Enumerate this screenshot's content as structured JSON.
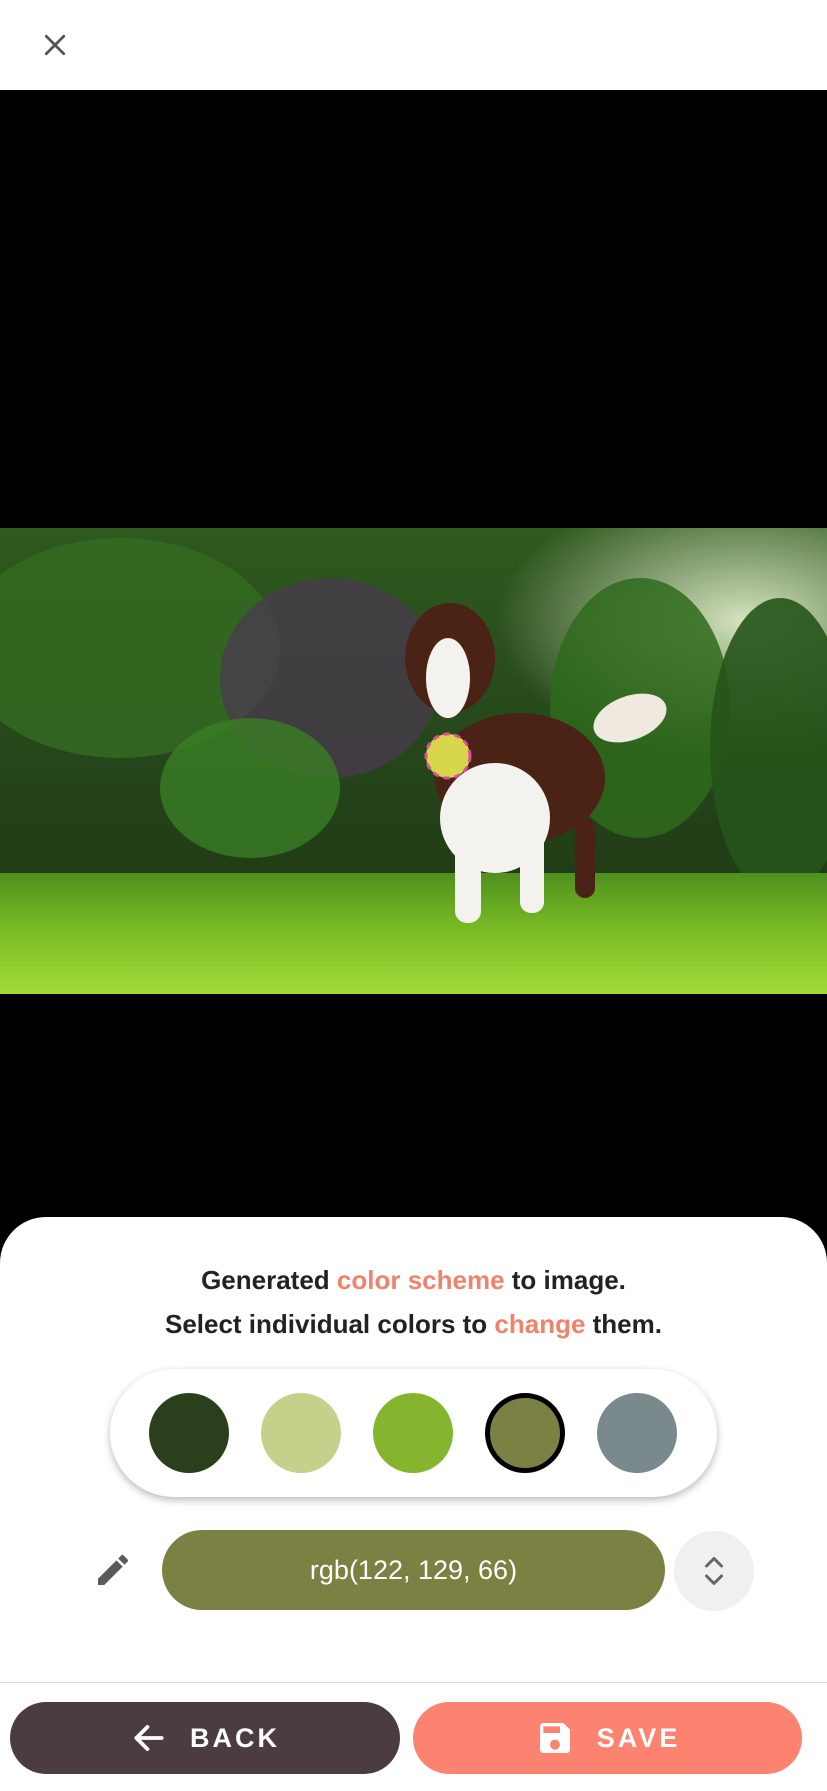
{
  "caption": {
    "line1_before": "Generated ",
    "line1_highlight": "color scheme",
    "line1_after": " to image.",
    "line2_before": "Select individual colors to ",
    "line2_highlight": "change",
    "line2_after": " them."
  },
  "palette": {
    "swatches": [
      {
        "color": "#2c3f1d",
        "selected": false
      },
      {
        "color": "#c5d08a",
        "selected": false
      },
      {
        "color": "#85b52e",
        "selected": false
      },
      {
        "color": "#7a8142",
        "selected": true
      },
      {
        "color": "#7a8a8c",
        "selected": false
      }
    ]
  },
  "color_field": {
    "value": "rgb(122, 129, 66)",
    "background": "#7a8142"
  },
  "buttons": {
    "back_label": "BACK",
    "save_label": "SAVE"
  },
  "icons": {
    "close": "close-icon",
    "edit": "pencil-icon",
    "stepper": "unfold-icon",
    "back": "arrow-left-icon",
    "save": "floppy-disk-icon"
  },
  "colors": {
    "accent": "#f0836b",
    "back_button": "#4a3c42",
    "save_button": "#fb8370"
  }
}
